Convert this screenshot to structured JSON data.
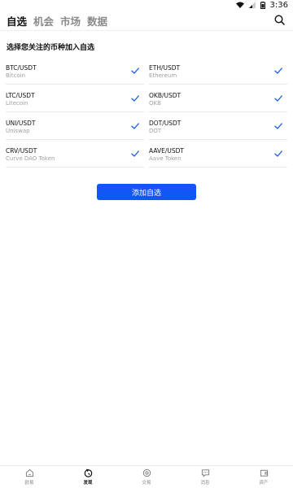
{
  "status_bar": {
    "time": "3:36"
  },
  "tabs": [
    {
      "label": "自选",
      "active": true
    },
    {
      "label": "机会",
      "active": false
    },
    {
      "label": "市场",
      "active": false
    },
    {
      "label": "数据",
      "active": false
    }
  ],
  "section": {
    "title": "选择您关注的币种加入自选"
  },
  "coins": [
    {
      "pair": "BTC/USDT",
      "name": "Bitcoin",
      "selected": true
    },
    {
      "pair": "ETH/USDT",
      "name": "Ethereum",
      "selected": true
    },
    {
      "pair": "LTC/USDT",
      "name": "Litecoin",
      "selected": true
    },
    {
      "pair": "OKB/USDT",
      "name": "OKB",
      "selected": true
    },
    {
      "pair": "UNI/USDT",
      "name": "Uniswap",
      "selected": true
    },
    {
      "pair": "DOT/USDT",
      "name": "DOT",
      "selected": true
    },
    {
      "pair": "CRV/USDT",
      "name": "Curve DAO Token",
      "selected": true
    },
    {
      "pair": "AAVE/USDT",
      "name": "Aave Token",
      "selected": true
    }
  ],
  "add_button": {
    "label": "添加自选"
  },
  "bottom_nav": [
    {
      "label": "欧易",
      "icon": "home-icon",
      "active": false
    },
    {
      "label": "发现",
      "icon": "discover-icon",
      "active": true
    },
    {
      "label": "交易",
      "icon": "trade-icon",
      "active": false
    },
    {
      "label": "消息",
      "icon": "message-icon",
      "active": false
    },
    {
      "label": "资产",
      "icon": "wallet-icon",
      "active": false
    }
  ],
  "colors": {
    "accent": "#1257f5",
    "check": "#1257f5",
    "muted": "#a0a0a0"
  }
}
